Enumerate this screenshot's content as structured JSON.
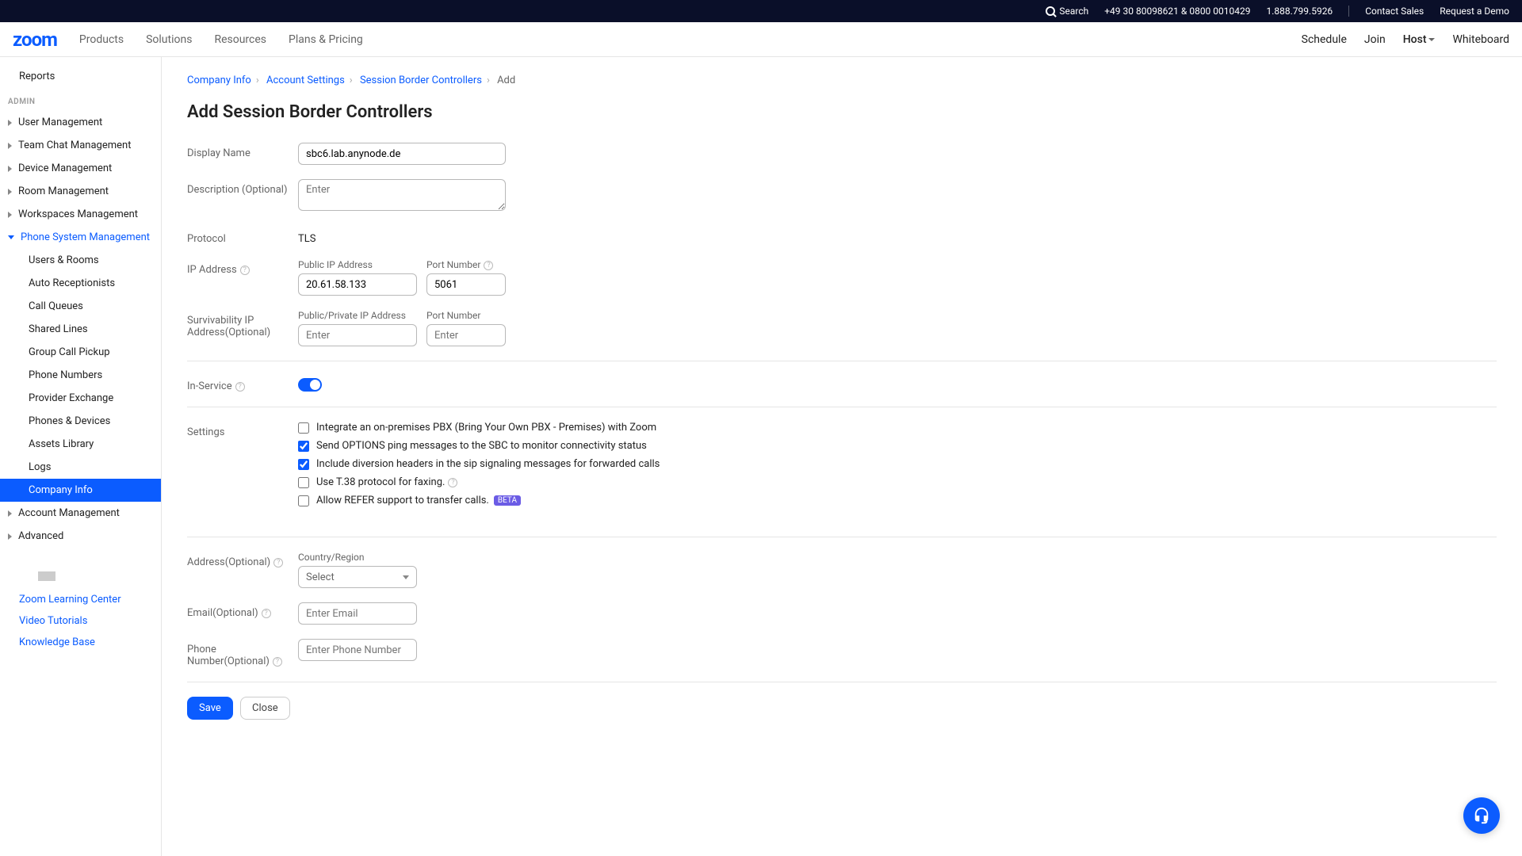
{
  "topbar": {
    "search": "Search",
    "phone1": "+49 30 80098621 & 0800 0010429",
    "phone2": "1.888.799.5926",
    "contact_sales": "Contact Sales",
    "request_demo": "Request a Demo"
  },
  "navbar": {
    "logo": "zoom",
    "products": "Products",
    "solutions": "Solutions",
    "resources": "Resources",
    "plans": "Plans & Pricing",
    "schedule": "Schedule",
    "join": "Join",
    "host": "Host",
    "whiteboard": "Whiteboard"
  },
  "sidebar": {
    "reports": "Reports",
    "admin_label": "ADMIN",
    "user_mgmt": "User Management",
    "team_chat_mgmt": "Team Chat Management",
    "device_mgmt": "Device Management",
    "room_mgmt": "Room Management",
    "workspaces_mgmt": "Workspaces Management",
    "phone_sys_mgmt": "Phone System Management",
    "users_rooms": "Users & Rooms",
    "auto_receptionists": "Auto Receptionists",
    "call_queues": "Call Queues",
    "shared_lines": "Shared Lines",
    "group_call_pickup": "Group Call Pickup",
    "phone_numbers": "Phone Numbers",
    "provider_exchange": "Provider Exchange",
    "phones_devices": "Phones & Devices",
    "assets_library": "Assets Library",
    "logs": "Logs",
    "company_info": "Company Info",
    "account_mgmt": "Account Management",
    "advanced": "Advanced",
    "learning_center": "Zoom Learning Center",
    "video_tutorials": "Video Tutorials",
    "knowledge_base": "Knowledge Base"
  },
  "breadcrumb": {
    "company_info": "Company Info",
    "account_settings": "Account Settings",
    "sbc": "Session Border Controllers",
    "add": "Add"
  },
  "page_title": "Add Session Border Controllers",
  "form": {
    "display_name_label": "Display Name",
    "display_name_value": "sbc6.lab.anynode.de",
    "description_label": "Description (Optional)",
    "description_placeholder": "Enter",
    "protocol_label": "Protocol",
    "protocol_value": "TLS",
    "ip_address_label": "IP Address",
    "public_ip_label": "Public IP Address",
    "public_ip_value": "20.61.58.133",
    "port_label": "Port Number",
    "port_value": "5061",
    "surv_ip_label": "Survivability IP Address(Optional)",
    "surv_public_ip_label": "Public/Private IP Address",
    "surv_public_ip_placeholder": "Enter",
    "surv_port_label": "Port Number",
    "surv_port_placeholder": "Enter",
    "in_service_label": "In-Service",
    "settings_label": "Settings",
    "cb_integrate": "Integrate an on-premises PBX (Bring Your Own PBX - Premises) with Zoom",
    "cb_options": "Send OPTIONS ping messages to the SBC to monitor connectivity status",
    "cb_diversion": "Include diversion headers in the sip signaling messages for forwarded calls",
    "cb_t38": "Use T.38 protocol for faxing.",
    "cb_refer": "Allow REFER support to transfer calls.",
    "beta": "BETA",
    "address_label": "Address(Optional)",
    "country_label": "Country/Region",
    "country_select": "Select",
    "email_label": "Email(Optional)",
    "email_placeholder": "Enter Email",
    "phone_label": "Phone Number(Optional)",
    "phone_placeholder": "Enter Phone Number",
    "save": "Save",
    "close": "Close"
  }
}
